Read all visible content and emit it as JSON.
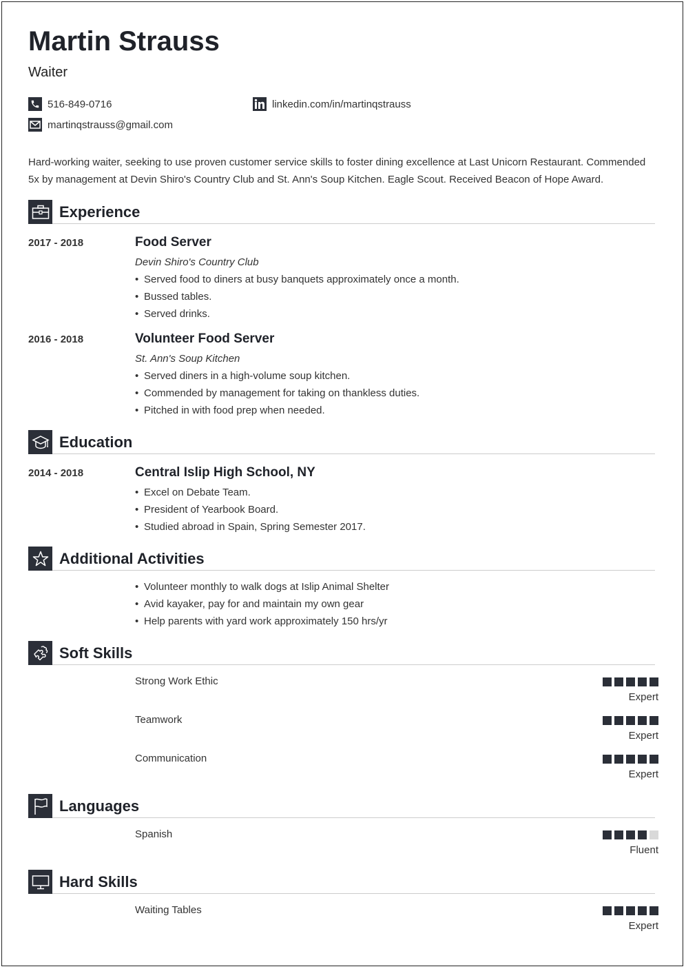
{
  "header": {
    "name": "Martin Strauss",
    "title": "Waiter",
    "phone": "516-849-0716",
    "email": "martinqstrauss@gmail.com",
    "linkedin": "linkedin.com/in/martinqstrauss"
  },
  "summary": "Hard-working waiter, seeking to use proven customer service skills to foster dining excellence at Last Unicorn Restaurant. Commended 5x by management at Devin Shiro's Country Club and St. Ann's Soup Kitchen. Eagle Scout. Received Beacon of Hope Award.",
  "sections": {
    "experience": "Experience",
    "education": "Education",
    "activities": "Additional Activities",
    "soft_skills": "Soft Skills",
    "languages": "Languages",
    "hard_skills": "Hard Skills"
  },
  "experience": [
    {
      "dates": "2017 - 2018",
      "title": "Food Server",
      "org": "Devin Shiro's Country Club",
      "bullets": [
        "Served food to diners at busy banquets approximately once a month.",
        "Bussed tables.",
        "Served drinks."
      ]
    },
    {
      "dates": "2016 - 2018",
      "title": "Volunteer Food Server",
      "org": "St. Ann's Soup Kitchen",
      "bullets": [
        "Served diners in a high-volume soup kitchen.",
        "Commended by management for taking on thankless duties.",
        "Pitched in with food prep when needed."
      ]
    }
  ],
  "education": [
    {
      "dates": "2014 - 2018",
      "title": "Central Islip High School, NY",
      "bullets": [
        "Excel on Debate Team.",
        "President of Yearbook Board.",
        "Studied abroad in Spain, Spring Semester 2017."
      ]
    }
  ],
  "activities": [
    "Volunteer monthly to walk dogs at Islip Animal Shelter",
    "Avid kayaker, pay for and maintain my own gear",
    "Help parents with yard work approximately 150 hrs/yr"
  ],
  "soft_skills": [
    {
      "name": "Strong Work Ethic",
      "rating": 5,
      "max": 5,
      "level": "Expert"
    },
    {
      "name": "Teamwork",
      "rating": 5,
      "max": 5,
      "level": "Expert"
    },
    {
      "name": "Communication",
      "rating": 5,
      "max": 5,
      "level": "Expert"
    }
  ],
  "languages": [
    {
      "name": "Spanish",
      "rating": 4,
      "max": 5,
      "level": "Fluent"
    }
  ],
  "hard_skills": [
    {
      "name": "Waiting Tables",
      "rating": 5,
      "max": 5,
      "level": "Expert"
    }
  ],
  "bullet_char": "•",
  "colors": {
    "accent": "#2b2f38",
    "inactive": "#d9d9d9"
  }
}
